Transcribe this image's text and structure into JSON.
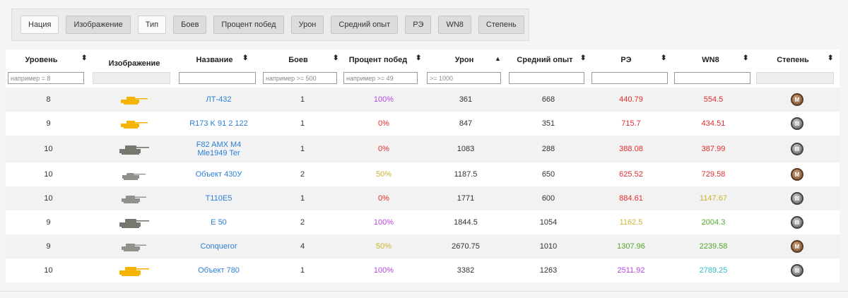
{
  "column_toggles": [
    {
      "label": "Нация",
      "active": true
    },
    {
      "label": "Изображение",
      "active": false
    },
    {
      "label": "Тип",
      "active": true
    },
    {
      "label": "Боев",
      "active": false
    },
    {
      "label": "Процент побед",
      "active": false
    },
    {
      "label": "Урон",
      "active": false
    },
    {
      "label": "Средний опыт",
      "active": false
    },
    {
      "label": "РЭ",
      "active": false
    },
    {
      "label": "WN8",
      "active": false
    },
    {
      "label": "Степень",
      "active": false
    }
  ],
  "headers": {
    "level": "Уровень",
    "image": "Изображение",
    "name": "Название",
    "battles": "Боев",
    "winrate": "Процент побед",
    "damage": "Урон",
    "avg_xp": "Средний опыт",
    "re": "РЭ",
    "wn8": "WN8",
    "mastery": "Степень"
  },
  "sort_icons": {
    "both": "⬍",
    "up": "▲"
  },
  "filters": {
    "level": "например = 8",
    "battles": "например >= 500",
    "winrate": "например >= 49",
    "damage": ">= 1000"
  },
  "colors": {
    "purple": "#b645e0",
    "red": "#e02d2d",
    "yellow": "#c9b32e",
    "green": "#55a82a",
    "teal": "#2fbbc7",
    "link": "#2a7fd4",
    "tank_gold": "#f6b400",
    "tank_gray": "#8f918a",
    "tank_dark": "#77776f"
  },
  "rows": [
    {
      "level": "8",
      "tank_color": "gold",
      "tank_shape": "light",
      "name": "ЛТ-432",
      "battles": "1",
      "winrate": "100%",
      "winrate_color": "purple",
      "damage": "361",
      "avg_xp": "668",
      "re": "440.79",
      "re_color": "red",
      "wn8": "554.5",
      "wn8_color": "red",
      "mastery": "bronze",
      "mastery_icon": "mastery-m-bronze-icon",
      "mastery_mark": "M"
    },
    {
      "level": "9",
      "tank_color": "gold",
      "tank_shape": "light",
      "name": "R173 K 91 2 122",
      "battles": "1",
      "winrate": "0%",
      "winrate_color": "red",
      "damage": "847",
      "avg_xp": "351",
      "re": "715.7",
      "re_color": "red",
      "wn8": "434.51",
      "wn8_color": "red",
      "mastery": "silver",
      "mastery_icon": "mastery-3-icon",
      "mastery_mark": "III"
    },
    {
      "level": "10",
      "tank_color": "dark",
      "tank_shape": "heavy",
      "name": "F82 AMX M4 Mle1949 Ter",
      "battles": "1",
      "winrate": "0%",
      "winrate_color": "red",
      "damage": "1083",
      "avg_xp": "288",
      "re": "388.08",
      "re_color": "red",
      "wn8": "387.99",
      "wn8_color": "red",
      "mastery": "silver",
      "mastery_icon": "mastery-3-icon",
      "mastery_mark": "III"
    },
    {
      "level": "10",
      "tank_color": "gray",
      "tank_shape": "low",
      "name": "Объект 430У",
      "battles": "2",
      "winrate": "50%",
      "winrate_color": "yellow",
      "damage": "1187.5",
      "avg_xp": "650",
      "re": "625.52",
      "re_color": "red",
      "wn8": "729.58",
      "wn8_color": "red",
      "mastery": "bronze",
      "mastery_icon": "mastery-m-bronze-icon",
      "mastery_mark": "M"
    },
    {
      "level": "10",
      "tank_color": "gray",
      "tank_shape": "medium",
      "name": "T110E5",
      "battles": "1",
      "winrate": "0%",
      "winrate_color": "red",
      "damage": "1771",
      "avg_xp": "600",
      "re": "884.61",
      "re_color": "red",
      "wn8": "1147.67",
      "wn8_color": "yellow",
      "mastery": "silver",
      "mastery_icon": "mastery-3-icon",
      "mastery_mark": "III"
    },
    {
      "level": "9",
      "tank_color": "dark",
      "tank_shape": "heavy",
      "name": "E 50",
      "battles": "2",
      "winrate": "100%",
      "winrate_color": "purple",
      "damage": "1844.5",
      "avg_xp": "1054",
      "re": "1162.5",
      "re_color": "yellow",
      "wn8": "2004.3",
      "wn8_color": "green",
      "mastery": "silver",
      "mastery_icon": "mastery-3-icon",
      "mastery_mark": "III"
    },
    {
      "level": "9",
      "tank_color": "gray",
      "tank_shape": "medium",
      "name": "Conqueror",
      "battles": "4",
      "winrate": "50%",
      "winrate_color": "yellow",
      "damage": "2670.75",
      "avg_xp": "1010",
      "re": "1307.96",
      "re_color": "green",
      "wn8": "2239.58",
      "wn8_color": "green",
      "mastery": "bronze",
      "mastery_icon": "mastery-m-bronze-icon",
      "mastery_mark": "M"
    },
    {
      "level": "10",
      "tank_color": "gold",
      "tank_shape": "heavy",
      "name": "Объект 780",
      "battles": "1",
      "winrate": "100%",
      "winrate_color": "purple",
      "damage": "3382",
      "avg_xp": "1263",
      "re": "2511.92",
      "re_color": "purple",
      "wn8": "2789.25",
      "wn8_color": "teal",
      "mastery": "silver",
      "mastery_icon": "mastery-3-icon",
      "mastery_mark": "III"
    }
  ]
}
